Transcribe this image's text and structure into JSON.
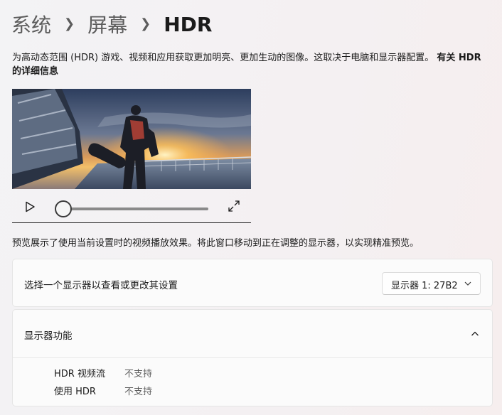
{
  "breadcrumb": {
    "items": [
      "系统",
      "屏幕"
    ],
    "current": "HDR"
  },
  "description": {
    "text": "为高动态范围 (HDR) 游戏、视频和应用获取更加明亮、更加生动的图像。这取决于电脑和显示器配置。",
    "link": "有关 HDR 的详细信息"
  },
  "video": {
    "progress": 0.0
  },
  "preview_note": "预览展示了使用当前设置时的视频播放效果。将此窗口移动到正在调整的显示器，以实现精准预览。",
  "display_select": {
    "label": "选择一个显示器以查看或更改其设置",
    "selected": "显示器 1: 27B2"
  },
  "features": {
    "title": "显示器功能",
    "rows": [
      {
        "name": "HDR 视频流",
        "value": "不支持"
      },
      {
        "name": "使用 HDR",
        "value": "不支持"
      }
    ]
  },
  "icons": {
    "play": "play-icon",
    "fullscreen": "fullscreen-icon",
    "dropdown": "chevron-down-icon",
    "collapse": "chevron-up-icon"
  }
}
